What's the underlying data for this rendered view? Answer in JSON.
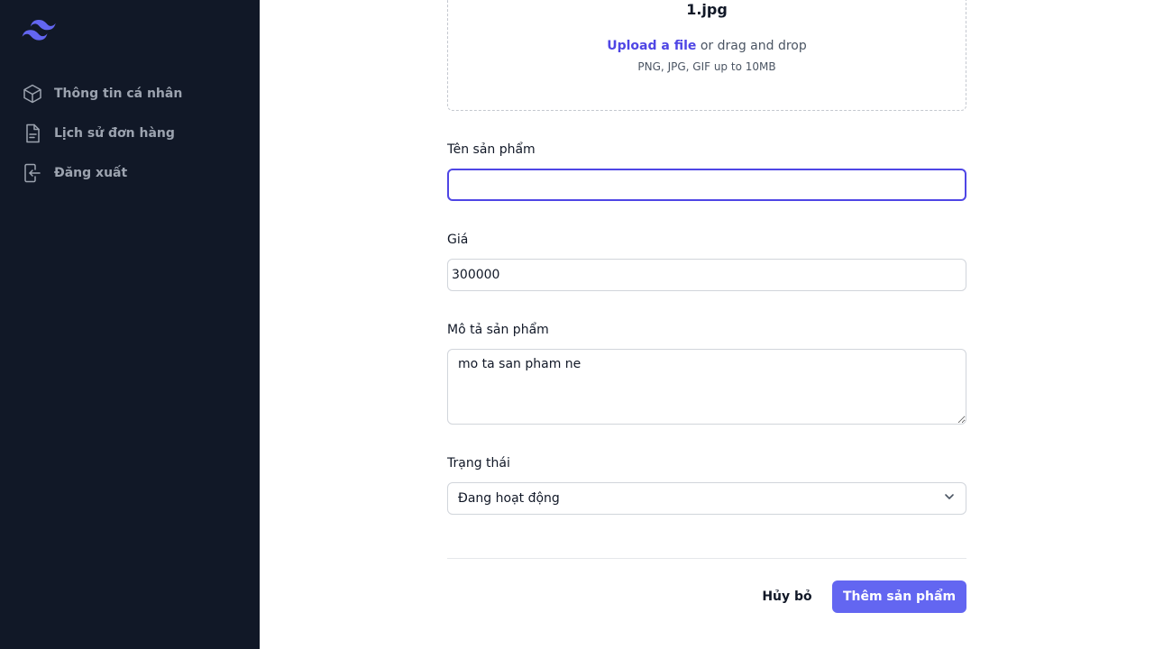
{
  "sidebar": {
    "logo_icon": "tailwind-logo-icon",
    "items": [
      {
        "icon": "cube-icon",
        "label": "Thông tin cá nhân"
      },
      {
        "icon": "document-icon",
        "label": "Lịch sử đơn hàng"
      },
      {
        "icon": "logout-icon",
        "label": "Đăng xuất"
      }
    ]
  },
  "upload": {
    "file_name": "1.jpg",
    "link_text": "Upload a file",
    "drag_text": " or drag and drop",
    "hint": "PNG, JPG, GIF up to 10MB"
  },
  "form": {
    "name": {
      "label": "Tên sản phẩm",
      "value": ""
    },
    "price": {
      "label": "Giá",
      "value": "300000"
    },
    "description": {
      "label": "Mô tả sản phẩm",
      "value": "mo ta san pham ne"
    },
    "status": {
      "label": "Trạng thái",
      "selected": "Đang hoạt động"
    }
  },
  "actions": {
    "cancel_label": "Hủy bỏ",
    "submit_label": "Thêm sản phẩm"
  },
  "colors": {
    "sidebar_bg": "#111827",
    "accent": "#6366f1",
    "link": "#4f46e5"
  }
}
